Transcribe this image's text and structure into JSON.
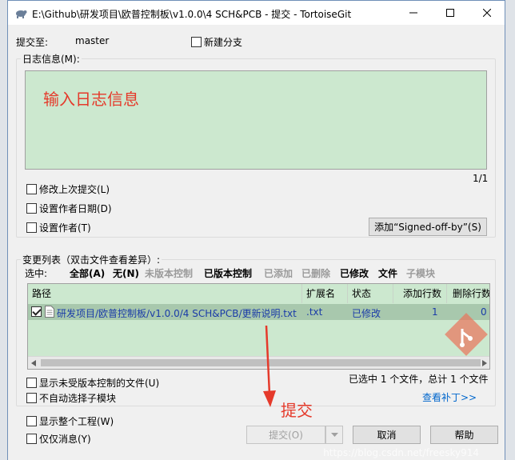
{
  "window": {
    "title": "E:\\Github\\研发项目\\欧普控制板\\v1.0.0\\4  SCH&PCB - 提交 - TortoiseGit"
  },
  "commit": {
    "commit_to_label": "提交至:",
    "branch": "master",
    "new_branch_label": "新建分支"
  },
  "message": {
    "group_label": "日志信息(M):",
    "text": "输入日志信息",
    "counter": "1/1"
  },
  "options": {
    "amend_label": "修改上次提交(L)",
    "set_date_label": "设置作者日期(D)",
    "set_author_label": "设置作者(T)",
    "signed_off_button": "添加“Signed-off-by”(S)"
  },
  "changes": {
    "group_label": "变更列表（双击文件查看差异）:",
    "select_label": "选中:",
    "filters": [
      {
        "label": "全部(A)"
      },
      {
        "label": "无(N)"
      },
      {
        "label": "未版本控制"
      },
      {
        "label": "已版本控制"
      },
      {
        "label": "已添加"
      },
      {
        "label": "已删除"
      },
      {
        "label": "已修改"
      },
      {
        "label": "文件"
      },
      {
        "label": "子模块"
      }
    ],
    "columns": [
      "路径",
      "扩展名",
      "状态",
      "添加行数",
      "删除行数"
    ],
    "rows": [
      {
        "path": "研发项目/欧普控制板/v1.0.0/4  SCH&PCB/更新说明.txt",
        "ext": ".txt",
        "status": "已修改",
        "added": "1",
        "deleted": "0"
      }
    ],
    "summary": "已选中 1 个文件，总计 1 个文件",
    "view_patch": "查看补丁>>",
    "show_unversioned_label": "显示未受版本控制的文件(U)",
    "no_autoselect_label": "不自动选择子模块"
  },
  "bottom": {
    "show_whole_project_label": "显示整个工程(W)",
    "message_only_label": "仅仅消息(Y)",
    "commit_button": "提交(O)",
    "cancel_button": "取消",
    "help_button": "帮助"
  },
  "annotation": {
    "text": "提交",
    "color": "#e53a2b"
  },
  "watermark": "https://blog.csdn.net/freesky914"
}
